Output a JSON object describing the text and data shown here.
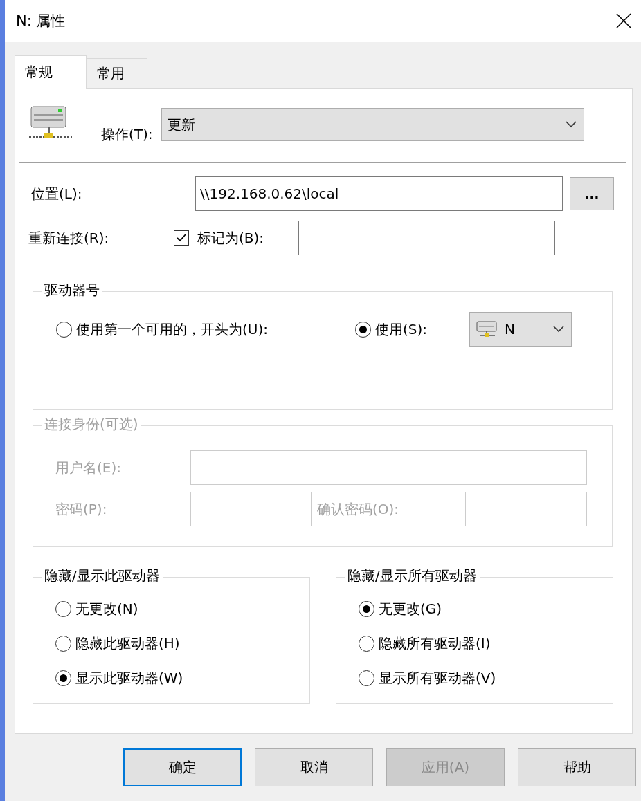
{
  "window": {
    "title": "N: 属性"
  },
  "tabs": [
    {
      "label": "常规",
      "selected": true
    },
    {
      "label": "常用",
      "selected": false
    }
  ],
  "action": {
    "label": "操作(T):",
    "value": "更新"
  },
  "location": {
    "label": "位置(L):",
    "value": "\\\\192.168.0.62\\local",
    "browse": "..."
  },
  "reconnect": {
    "label": "重新连接(R):",
    "checked": true
  },
  "label_as": {
    "label": "标记为(B):"
  },
  "drive_letter": {
    "title": "驱动器号",
    "options": [
      {
        "label": "使用第一个可用的，开头为(U):",
        "selected": false
      },
      {
        "label": "使用(S):",
        "selected": true
      }
    ],
    "drive": "N"
  },
  "credentials": {
    "title": "连接身份(可选)",
    "disabled": true,
    "user": "用户名(E):",
    "password": "密码(P):",
    "confirm": "确认密码(O):"
  },
  "hide_show_groups": [
    {
      "title": "隐藏/显示此驱动器",
      "options": [
        {
          "label": "无更改(N)",
          "selected": false
        },
        {
          "label": "隐藏此驱动器(H)",
          "selected": false
        },
        {
          "label": "显示此驱动器(W)",
          "selected": true
        }
      ]
    },
    {
      "title": "隐藏/显示所有驱动器",
      "options": [
        {
          "label": "无更改(G)",
          "selected": true
        },
        {
          "label": "隐藏所有驱动器(I)",
          "selected": false
        },
        {
          "label": "显示所有驱动器(V)",
          "selected": false
        }
      ]
    }
  ],
  "buttons": [
    {
      "label": "确定",
      "default": true,
      "disabled": false
    },
    {
      "label": "取消",
      "default": false,
      "disabled": false
    },
    {
      "label": "应用(A)",
      "default": false,
      "disabled": true
    },
    {
      "label": "帮助",
      "default": false,
      "disabled": false
    }
  ]
}
